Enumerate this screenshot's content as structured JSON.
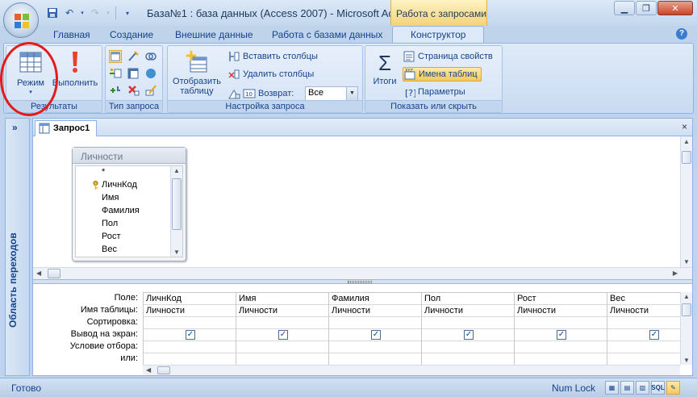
{
  "window": {
    "title": "База№1 : база данных (Access 2007) - Microsoft Acc...",
    "context_tab": "Работа с запросами"
  },
  "tabs": [
    {
      "label": "Главная"
    },
    {
      "label": "Создание"
    },
    {
      "label": "Внешние данные"
    },
    {
      "label": "Работа с базами данных"
    },
    {
      "label": "Конструктор"
    }
  ],
  "ribbon": {
    "results": {
      "label": "Результаты",
      "mode": "Режим",
      "run": "Выполнить"
    },
    "query_type": {
      "label": "Тип запроса"
    },
    "query_setup": {
      "label": "Настройка запроса",
      "show_table_line1": "Отобразить",
      "show_table_line2": "таблицу",
      "insert_columns": "Вставить столбцы",
      "delete_columns": "Удалить столбцы",
      "return_label": "Возврат:",
      "return_value": "Все"
    },
    "show_hide": {
      "label": "Показать или скрыть",
      "totals": "Итоги",
      "property_sheet": "Страница свойств",
      "table_names": "Имена таблиц",
      "parameters": "Параметры"
    }
  },
  "nav_pane": {
    "toggle": "»",
    "label": "Область переходов"
  },
  "document": {
    "tab": "Запрос1",
    "close": "×"
  },
  "table": {
    "name": "Личности",
    "fields": [
      "*",
      "ЛичнКод",
      "Имя",
      "Фамилия",
      "Пол",
      "Рост",
      "Вес"
    ]
  },
  "grid": {
    "row_labels": [
      "Поле:",
      "Имя таблицы:",
      "Сортировка:",
      "Вывод на экран:",
      "Условие отбора:",
      "или:"
    ],
    "columns": [
      {
        "field": "ЛичнКод",
        "table": "Личности",
        "show": true
      },
      {
        "field": "Имя",
        "table": "Личности",
        "show": true
      },
      {
        "field": "Фамилия",
        "table": "Личности",
        "show": true
      },
      {
        "field": "Пол",
        "table": "Личности",
        "show": true
      },
      {
        "field": "Рост",
        "table": "Личности",
        "show": true
      },
      {
        "field": "Вес",
        "table": "Личности",
        "show": true
      }
    ],
    "check_mark": "✓"
  },
  "statusbar": {
    "left": "Готово",
    "numlock": "Num Lock",
    "sql": "SQL"
  }
}
